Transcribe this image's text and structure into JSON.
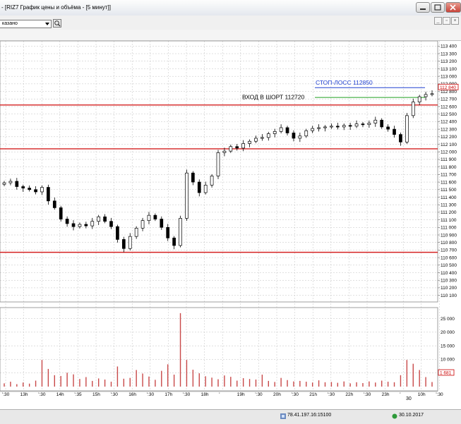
{
  "window": {
    "title": "- [RIZ7 График цены и объёма - [5 минут]]"
  },
  "toolbar": {
    "combo_value": "казано"
  },
  "chart": {
    "price_axis": {
      "ticks": [
        "113 400",
        "113 300",
        "113 200",
        "113 100",
        "113 000",
        "112 900",
        "112 800",
        "112 700",
        "112 600",
        "112 500",
        "112 400",
        "112 300",
        "112 200",
        "112 100",
        "112 000",
        "111 900",
        "111 800",
        "111 700",
        "111 600",
        "111 500",
        "111 400",
        "111 300",
        "111 200",
        "111 100",
        "111 000",
        "110 900",
        "110 800",
        "110 700",
        "110 600",
        "110 500",
        "110 400",
        "110 300",
        "110 200",
        "110 100"
      ],
      "current_price_label": "112 840"
    },
    "volume_axis": {
      "ticks": [
        "25 000",
        "20 000",
        "15 000",
        "10 000",
        "5 000"
      ],
      "current_volume_label": "1 681"
    },
    "time_axis": {
      "ticks": [
        "':30",
        "13h",
        "':30",
        "14h",
        "':35",
        "15h",
        "':30",
        "16h",
        "':30",
        "17h",
        "':30",
        "18h",
        "'",
        "19h",
        "':30",
        "20h",
        "':30",
        "21h",
        "':30",
        "22h",
        "':30",
        "23h",
        "'",
        "10h",
        "':30"
      ],
      "sub_label": "30"
    },
    "annotations": {
      "stop_loss": "СТОП-ЛОСС 112850",
      "short_entry": "ВХОД В ШОРТ 112720"
    },
    "colors": {
      "support_resistance": "#d42020",
      "stop_loss": "#2040d0",
      "short_entry": "#20a020",
      "volume": "#c84848",
      "grid": "#b8b8b8"
    }
  },
  "statusbar": {
    "ip": "78.41.197.16:15100",
    "date": "30.10.2017"
  },
  "chart_data": {
    "type": "candlestick",
    "ylim": [
      110050,
      113450
    ],
    "horizontal_levels": [
      112620,
      112040,
      110670
    ],
    "stop_loss": 112850,
    "short_entry": 112720,
    "series": [
      {
        "name": "price",
        "values": [
          111590,
          111610,
          111540,
          111520,
          111500,
          111470,
          111530,
          111350,
          111260,
          111110,
          111050,
          111010,
          111040,
          111020,
          111080,
          111140,
          111080,
          111010,
          110840,
          110720,
          110880,
          110990,
          111090,
          111160,
          111110,
          111000,
          110860,
          110760,
          111120,
          111720,
          111600,
          111460,
          111560,
          111680,
          111990,
          112010,
          112070,
          112050,
          112110,
          112140,
          112180,
          112190,
          112240,
          112270,
          112320,
          112250,
          112180,
          112210,
          112280,
          112310,
          112320,
          112330,
          112340,
          112330,
          112350,
          112340,
          112370,
          112360,
          112380,
          112420,
          112330,
          112300,
          112230,
          112130,
          112480,
          112660,
          112730,
          112760,
          112770
        ]
      },
      {
        "name": "volume",
        "values": [
          1200,
          1800,
          900,
          1500,
          1100,
          2200,
          9800,
          6500,
          4200,
          3900,
          5100,
          4500,
          2800,
          3500,
          2100,
          3000,
          2600,
          1800,
          7400,
          2900,
          3200,
          6100,
          4800,
          3700,
          2500,
          5800,
          8200,
          4400,
          27000,
          9800,
          6200,
          4900,
          3800,
          3300,
          2700,
          4100,
          3600,
          2200,
          3100,
          2800,
          2600,
          4400,
          2100,
          1700,
          3200,
          2400,
          1900,
          2100,
          1800,
          1500,
          2300,
          1600,
          1700,
          1400,
          1900,
          1200,
          1600,
          1300,
          1900,
          1500,
          2200,
          1800,
          1600,
          4200,
          9800,
          8400,
          6100,
          3500,
          1681
        ]
      }
    ]
  }
}
